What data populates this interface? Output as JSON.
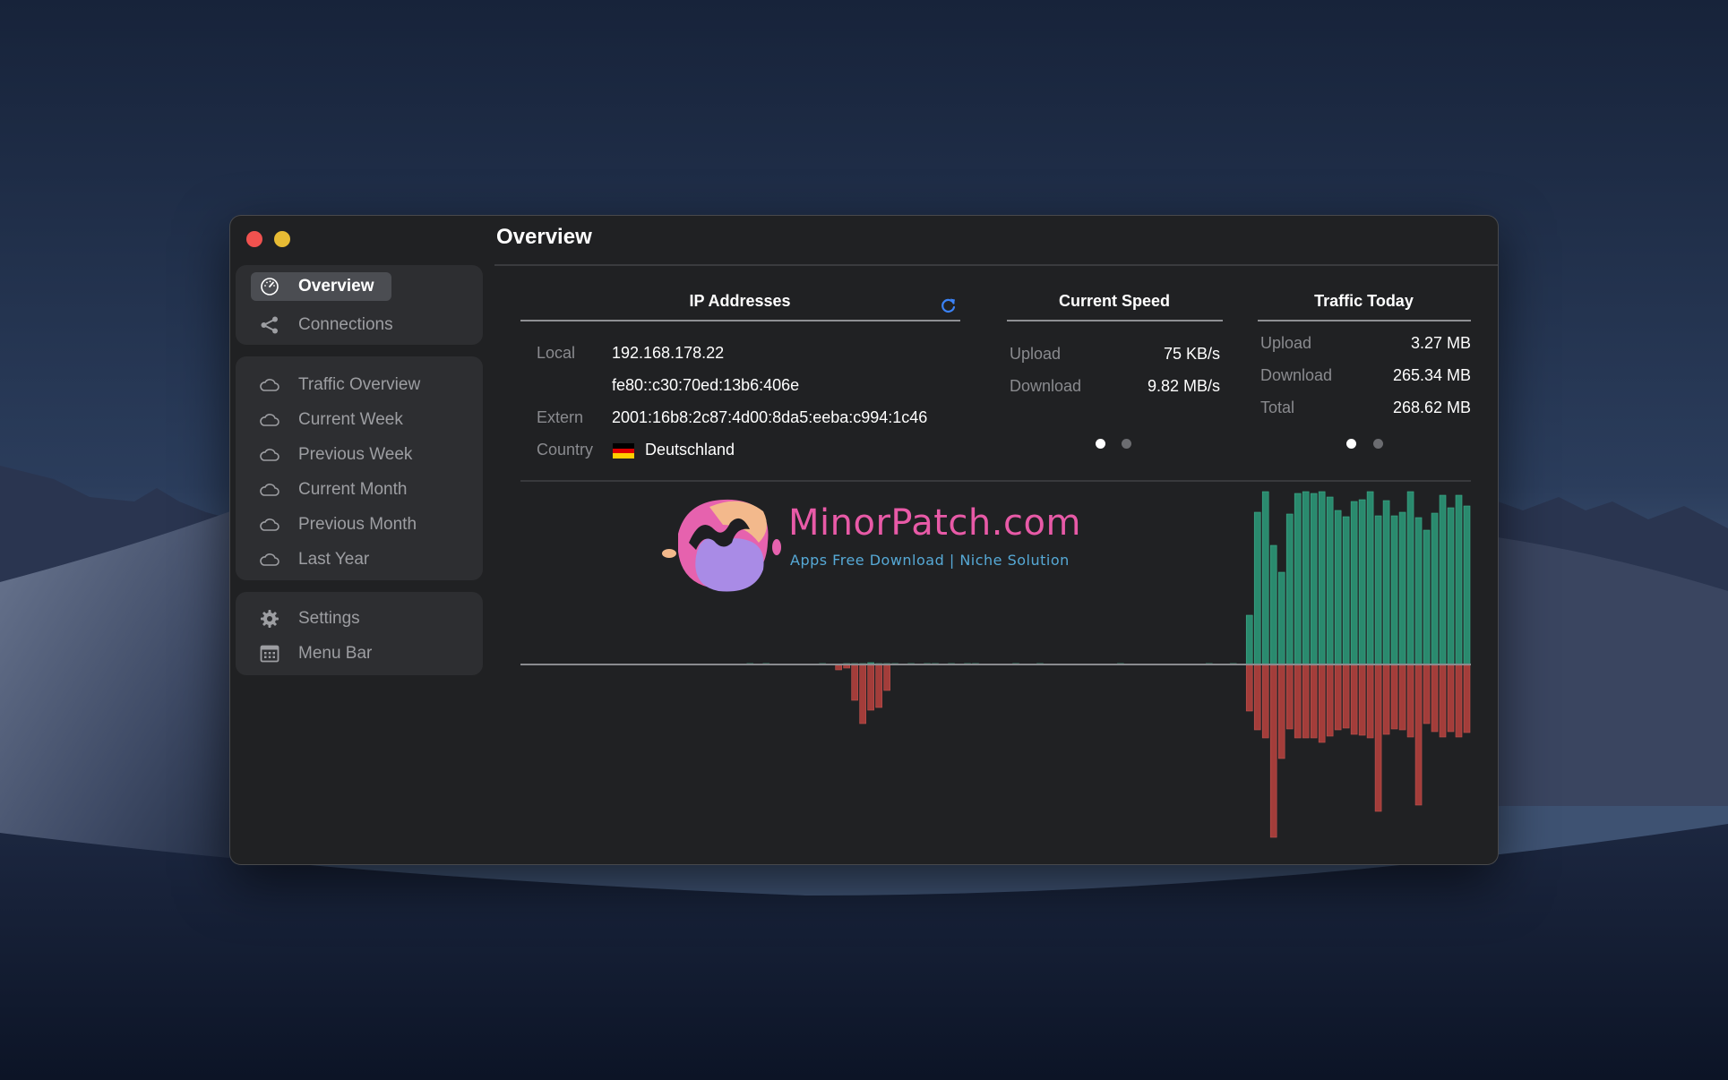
{
  "window": {
    "title": "Overview",
    "controls": [
      "close",
      "minimize"
    ]
  },
  "sidebar": {
    "groups": [
      {
        "items": [
          {
            "label": "Overview",
            "icon": "gauge-icon",
            "active": true
          },
          {
            "label": "Connections",
            "icon": "share-icon",
            "active": false
          }
        ]
      },
      {
        "items": [
          {
            "label": "Traffic Overview",
            "icon": "cloud-icon"
          },
          {
            "label": "Current Week",
            "icon": "cloud-icon"
          },
          {
            "label": "Previous Week",
            "icon": "cloud-icon"
          },
          {
            "label": "Current Month",
            "icon": "cloud-icon"
          },
          {
            "label": "Previous Month",
            "icon": "cloud-icon"
          },
          {
            "label": "Last Year",
            "icon": "cloud-icon"
          }
        ]
      },
      {
        "items": [
          {
            "label": "Settings",
            "icon": "gear-icon"
          },
          {
            "label": "Menu Bar",
            "icon": "calendar-grid-icon"
          }
        ]
      }
    ]
  },
  "ip_addresses": {
    "title": "IP Addresses",
    "refresh_icon": "refresh-icon",
    "rows": [
      {
        "label": "Local",
        "value": "192.168.178.22"
      },
      {
        "label": "",
        "value": "fe80::c30:70ed:13b6:406e"
      },
      {
        "label": "Extern",
        "value": "2001:16b8:2c87:4d00:8da5:eeba:c994:1c46"
      },
      {
        "label": "Country",
        "value": "Deutschland",
        "flag": "germany-flag"
      }
    ],
    "flag_colors": [
      "#000000",
      "#dd0000",
      "#ffce00"
    ]
  },
  "current_speed": {
    "title": "Current Speed",
    "rows": [
      {
        "label": "Upload",
        "value": "75 KB/s"
      },
      {
        "label": "Download",
        "value": "9.82 MB/s"
      }
    ],
    "page": 1,
    "pages": 2
  },
  "traffic_today": {
    "title": "Traffic Today",
    "rows": [
      {
        "label": "Upload",
        "value": "3.27 MB"
      },
      {
        "label": "Download",
        "value": "265.34 MB"
      },
      {
        "label": "Total",
        "value": "268.62 MB"
      }
    ],
    "page": 1,
    "pages": 2
  },
  "watermark": {
    "title": "MinorPatch.com",
    "subtitle": "Apps Free Download | Niche Solution"
  },
  "colors": {
    "upload_bar": "#2a8a6e",
    "download_bar": "#a33d3a",
    "accent": "#3b82f6"
  },
  "chart_data": {
    "type": "bar",
    "title": "",
    "xlabel": "",
    "ylabel": "",
    "bar_count": 118,
    "series": [
      {
        "name": "Download",
        "direction": "up",
        "values_by_index": {
          "29": 1,
          "31": 1,
          "38": 1,
          "41": 1,
          "42": 1,
          "43": 1,
          "44": 2,
          "45": 1,
          "46": 1,
          "47": 1,
          "49": 1,
          "51": 1,
          "52": 1,
          "54": 1,
          "56": 1,
          "57": 1,
          "62": 1,
          "65": 1,
          "75": 1,
          "86": 1,
          "89": 1,
          "91": 55,
          "92": 170,
          "93": 193,
          "94": 133,
          "95": 103,
          "96": 168,
          "97": 191,
          "98": 193,
          "99": 191,
          "100": 193,
          "101": 187,
          "102": 172,
          "103": 165,
          "104": 182,
          "105": 184,
          "106": 193,
          "107": 166,
          "108": 183,
          "109": 166,
          "110": 170,
          "111": 193,
          "112": 164,
          "113": 150,
          "114": 169,
          "115": 189,
          "116": 175,
          "117": 189,
          "118": 177
        }
      },
      {
        "name": "Upload",
        "direction": "down",
        "values_by_index": {
          "40": 5,
          "41": 3,
          "42": 39,
          "43": 65,
          "44": 50,
          "45": 47,
          "46": 28,
          "91": 51,
          "92": 72,
          "93": 81,
          "94": 192,
          "95": 104,
          "96": 71,
          "97": 81,
          "98": 81,
          "99": 81,
          "100": 86,
          "101": 79,
          "102": 72,
          "103": 70,
          "104": 77,
          "105": 78,
          "106": 81,
          "107": 163,
          "108": 77,
          "109": 71,
          "110": 72,
          "111": 80,
          "112": 156,
          "113": 65,
          "114": 74,
          "115": 80,
          "116": 74,
          "117": 80,
          "118": 75
        }
      }
    ],
    "ylim": [
      -200,
      200
    ],
    "grid": false,
    "legend": "none"
  }
}
